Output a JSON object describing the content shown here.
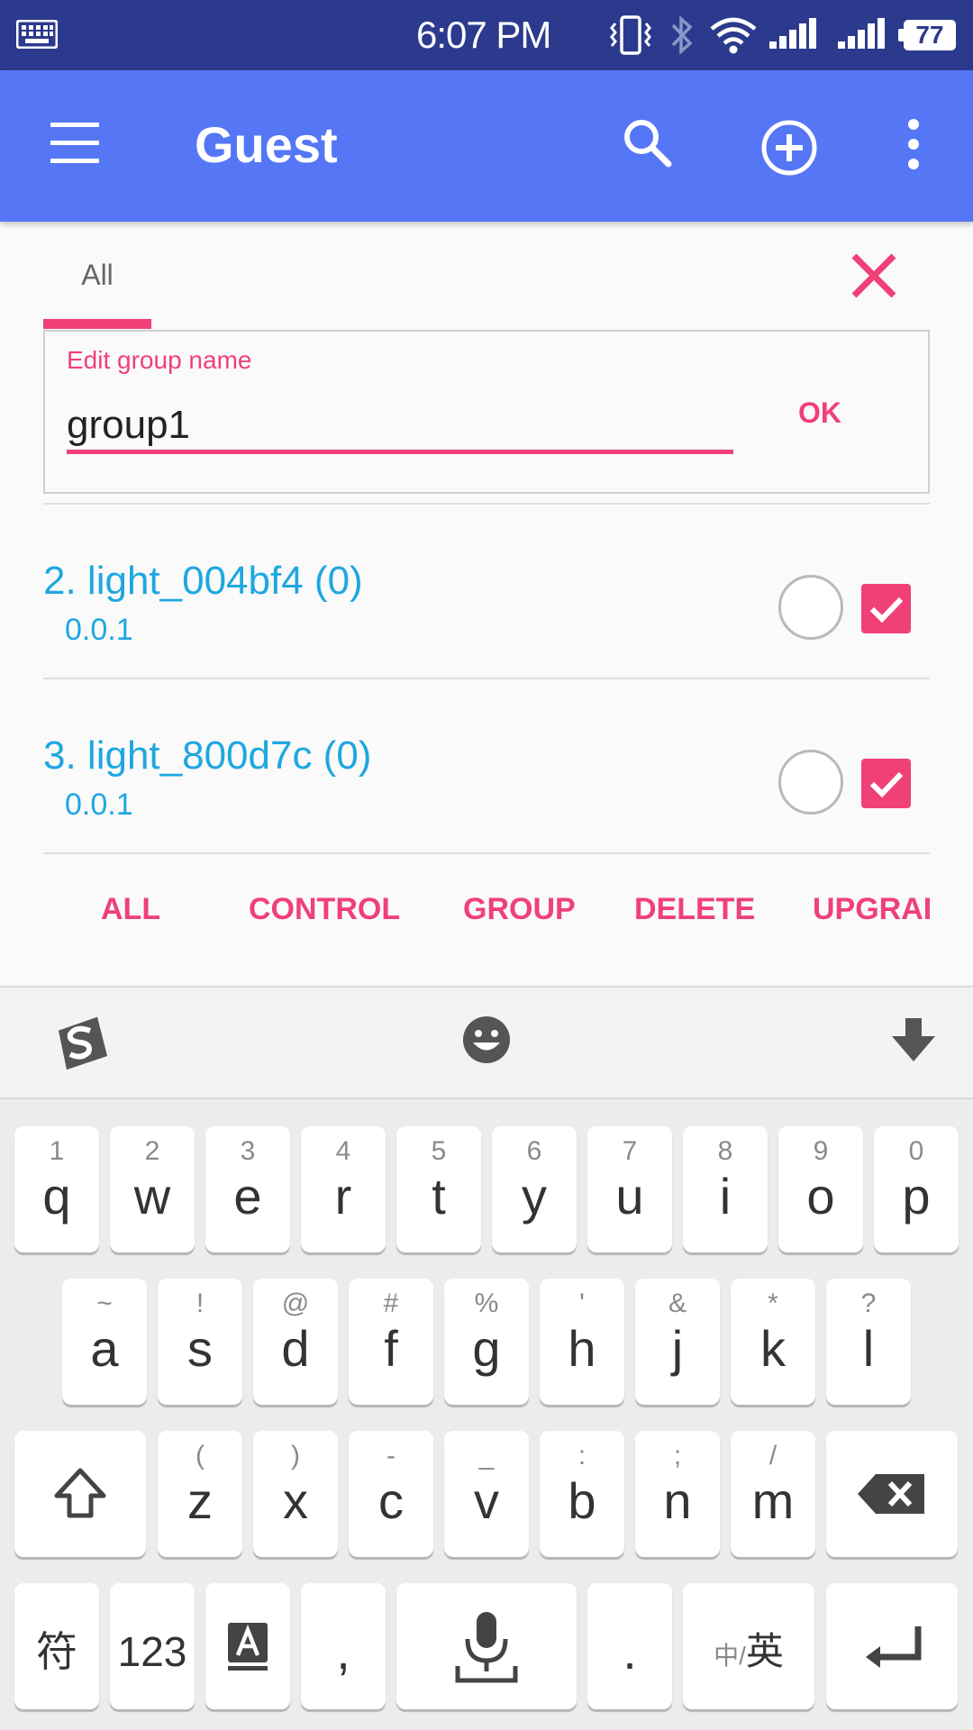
{
  "status_bar": {
    "time": "6:07 PM",
    "battery": "77",
    "icons": [
      "keyboard-icon",
      "vibrate-icon",
      "bluetooth-icon",
      "wifi-icon",
      "signal-icon",
      "signal-icon"
    ]
  },
  "app_bar": {
    "title": "Guest",
    "icons": [
      "menu-icon",
      "search-icon",
      "add-circle-icon",
      "more-vert-icon"
    ]
  },
  "tabs": [
    {
      "label": "All",
      "selected": true
    }
  ],
  "edit_group": {
    "label": "Edit group name",
    "value": "group1",
    "ok_label": "OK"
  },
  "devices": [
    {
      "name": "2. light_004bf4 (0)",
      "version": "0.0.1",
      "checked": true
    },
    {
      "name": "3. light_800d7c (0)",
      "version": "0.0.1",
      "checked": true
    }
  ],
  "actions": [
    {
      "label": "ALL"
    },
    {
      "label": "CONTROL"
    },
    {
      "label": "GROUP"
    },
    {
      "label": "DELETE"
    },
    {
      "label": "UPGRAD"
    }
  ],
  "keyboard": {
    "row1": [
      {
        "main": "q",
        "sub": "1"
      },
      {
        "main": "w",
        "sub": "2"
      },
      {
        "main": "e",
        "sub": "3"
      },
      {
        "main": "r",
        "sub": "4"
      },
      {
        "main": "t",
        "sub": "5"
      },
      {
        "main": "y",
        "sub": "6"
      },
      {
        "main": "u",
        "sub": "7"
      },
      {
        "main": "i",
        "sub": "8"
      },
      {
        "main": "o",
        "sub": "9"
      },
      {
        "main": "p",
        "sub": "0"
      }
    ],
    "row2": [
      {
        "main": "a",
        "sub": "~"
      },
      {
        "main": "s",
        "sub": "!"
      },
      {
        "main": "d",
        "sub": "@"
      },
      {
        "main": "f",
        "sub": "#"
      },
      {
        "main": "g",
        "sub": "%"
      },
      {
        "main": "h",
        "sub": "'"
      },
      {
        "main": "j",
        "sub": "&"
      },
      {
        "main": "k",
        "sub": "*"
      },
      {
        "main": "l",
        "sub": "?"
      }
    ],
    "row3": [
      {
        "main": "z",
        "sub": "("
      },
      {
        "main": "x",
        "sub": ")"
      },
      {
        "main": "c",
        "sub": "-"
      },
      {
        "main": "v",
        "sub": "_"
      },
      {
        "main": "b",
        "sub": ":"
      },
      {
        "main": "n",
        "sub": ";"
      },
      {
        "main": "m",
        "sub": "/"
      }
    ],
    "row4": {
      "symbols": "符",
      "numbers": "123",
      "comma": ",",
      "period": ".",
      "lang_small": "中/",
      "lang_big": "英"
    }
  },
  "colors": {
    "status_bar": "#2b3a8c",
    "app_bar": "#5577f5",
    "accent": "#f04078",
    "device_text": "#1ea7e1"
  }
}
